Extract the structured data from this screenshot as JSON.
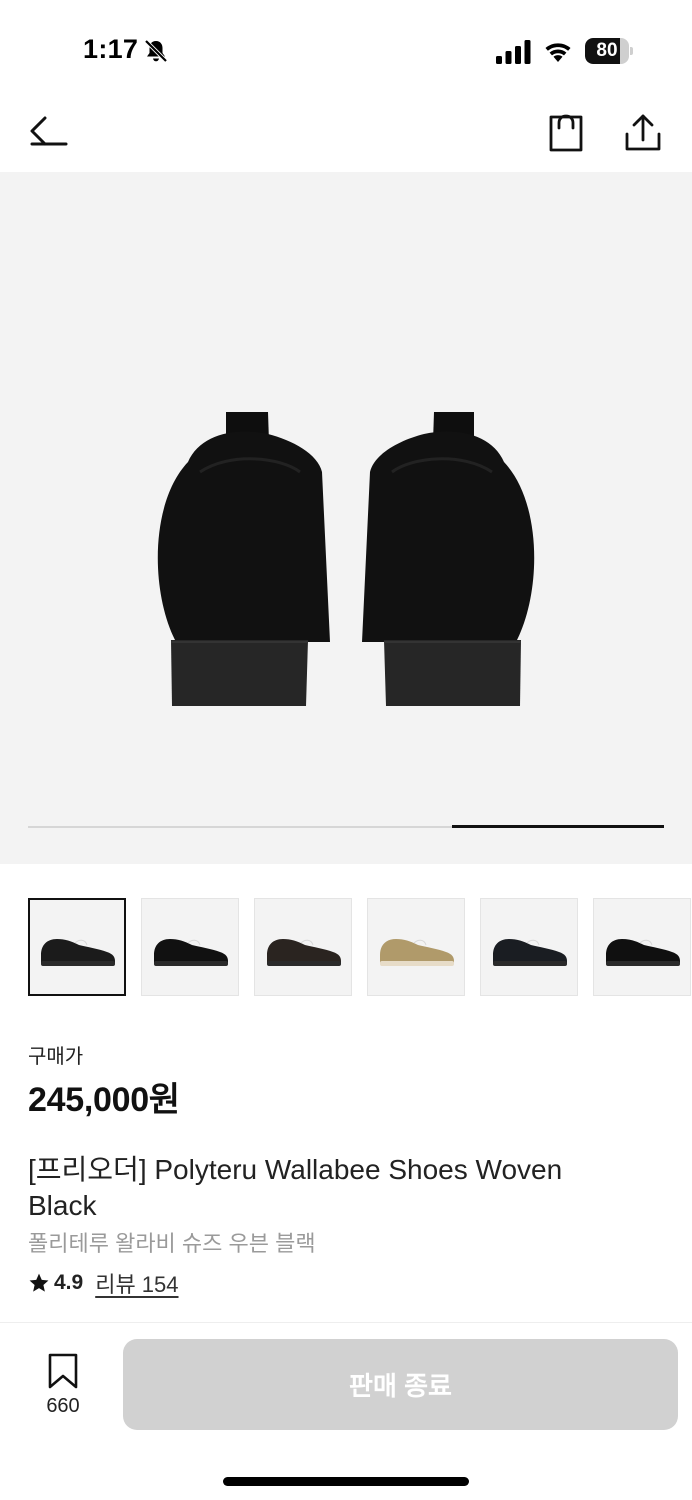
{
  "status_bar": {
    "time": "1:17",
    "battery_level": "80",
    "battery_fraction": 0.8,
    "icons": [
      "bell-off-icon",
      "signal-icon",
      "wifi-icon",
      "battery-icon"
    ]
  },
  "nav": {
    "icons": [
      "arrow-left-icon",
      "shopping-bag-icon",
      "share-icon"
    ]
  },
  "gallery": {
    "position_fraction_start": 0.667,
    "position_fraction_end": 1.0,
    "thumbnail_colors": [
      "#1b1b1b",
      "#111111",
      "#2a2420",
      "#b09a6a",
      "#1a1d22",
      "#101010"
    ],
    "sole_colors": [
      "#2a2a2a",
      "#2a2a2a",
      "#2a2a2a",
      "#e7dcc8",
      "#2a2a2a",
      "#2a2a2a"
    ]
  },
  "product": {
    "price_label": "구매가",
    "price": "245,000원",
    "title": "[프리오더] Polyteru Wallabee Shoes Woven Black",
    "subtitle": "폴리테루 왈라비 슈즈 우븐 블랙",
    "rating": "4.9",
    "review_link": "리뷰 154"
  },
  "bottom_bar": {
    "bookmark_count": "660",
    "action_label": "판매 종료"
  }
}
